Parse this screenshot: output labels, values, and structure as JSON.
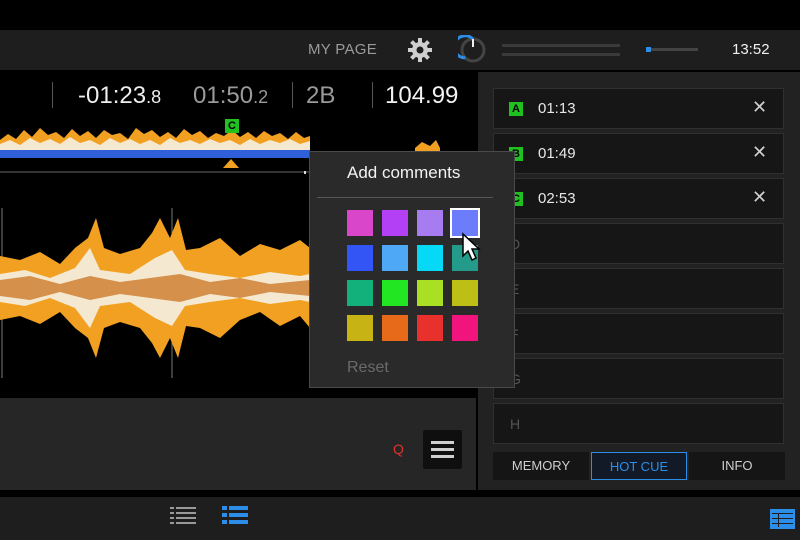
{
  "header": {
    "my_page": "MY PAGE",
    "clock": "13:52",
    "accent": "#2c8ee8"
  },
  "deck": {
    "remain_main": "-01:23",
    "remain_frac": ".8",
    "elapsed_main": "01:50",
    "elapsed_frac": ".2",
    "key": "2B",
    "bpm": "104.99",
    "cue_marker": "C",
    "quantize": "Q"
  },
  "hot_cues": [
    {
      "letter": "A",
      "time": "01:13",
      "color": "#20c020"
    },
    {
      "letter": "B",
      "time": "01:49",
      "color": "#20c020"
    },
    {
      "letter": "C",
      "time": "02:53",
      "color": "#20c020"
    },
    {
      "letter": "D",
      "time": ""
    },
    {
      "letter": "E",
      "time": ""
    },
    {
      "letter": "F",
      "time": ""
    },
    {
      "letter": "G",
      "time": ""
    },
    {
      "letter": "H",
      "time": ""
    }
  ],
  "tabs": {
    "memory": "MEMORY",
    "hot_cue": "HOT CUE",
    "info": "INFO"
  },
  "popup": {
    "title": "Add comments",
    "reset": "Reset",
    "colors": [
      "#d946c9",
      "#b340f5",
      "#a77cf0",
      "#6b7dfa",
      "#3355f5",
      "#4fa8f5",
      "#06d9f5",
      "#239a8a",
      "#12b07a",
      "#22e622",
      "#a9e024",
      "#bdbf16",
      "#c7b414",
      "#e66a1a",
      "#e8302c",
      "#f0147c"
    ],
    "selected_index": 3
  },
  "icons": {
    "gear": "gear-icon",
    "knob": "volume-knob-icon",
    "menu": "hamburger-menu-icon",
    "list1": "track-list-icon",
    "list2": "playlist-icon",
    "browse": "browse-icon",
    "close": "close-icon",
    "cursor": "mouse-pointer-icon"
  }
}
